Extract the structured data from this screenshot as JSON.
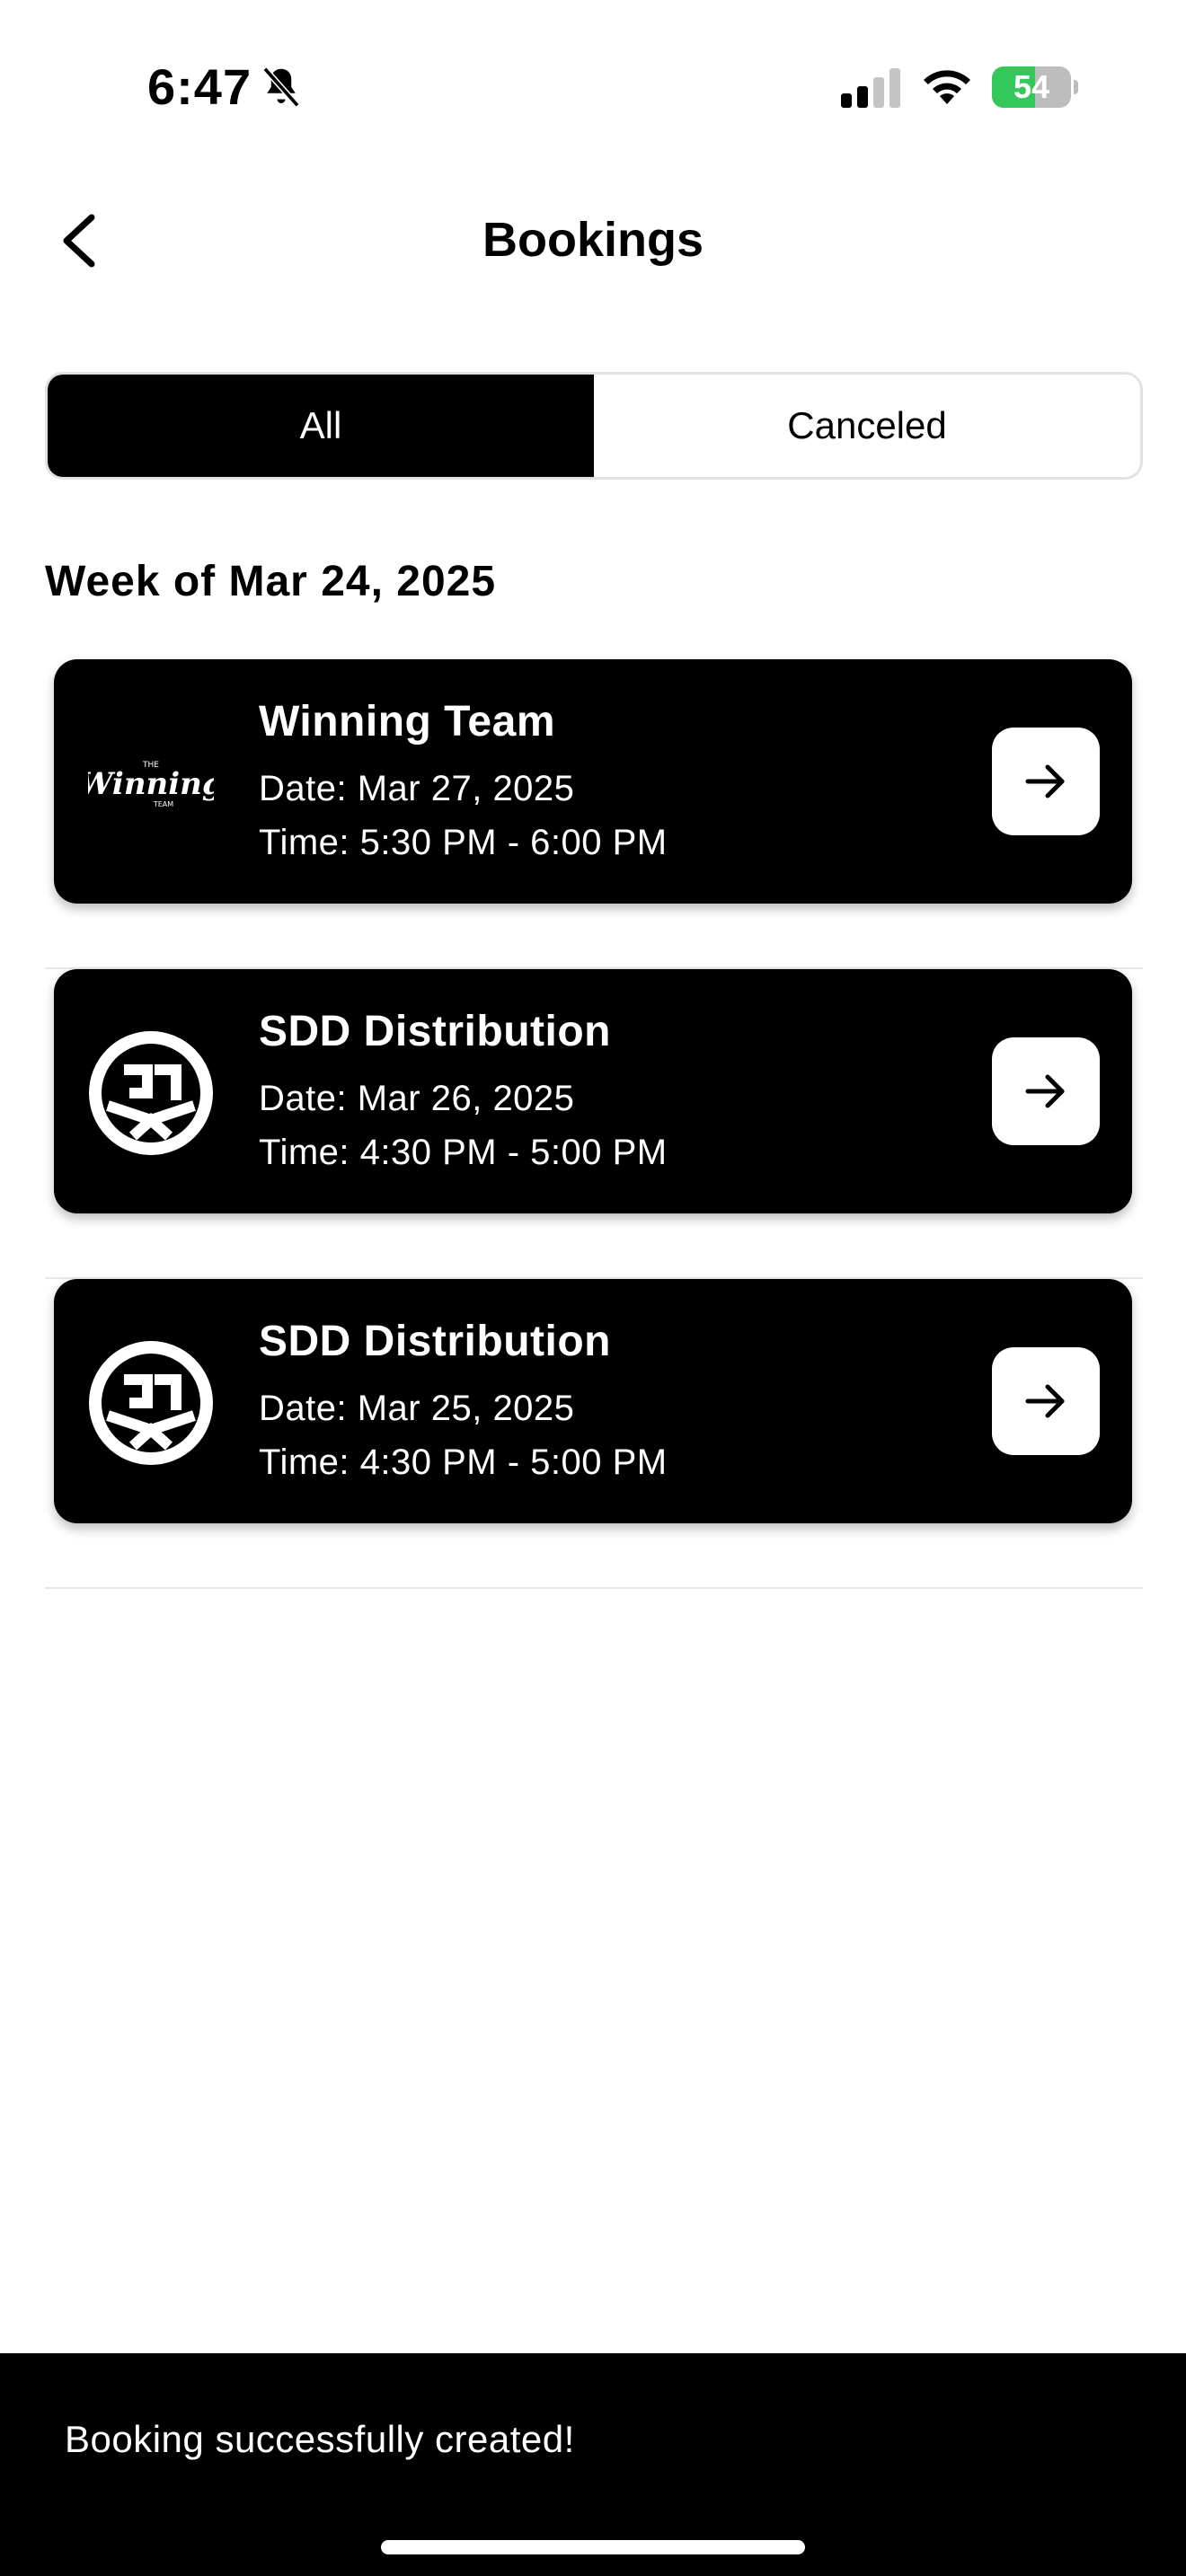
{
  "status_bar": {
    "time": "6:47",
    "battery_level": "54",
    "battery_fraction": 0.54,
    "battery_color": "#34c759",
    "icons": [
      "bell-slash-icon",
      "cellular-signal-icon",
      "wifi-icon",
      "battery-icon"
    ]
  },
  "header": {
    "title": "Bookings",
    "back_icon": "chevron-left-icon"
  },
  "tabs": [
    {
      "label": "All",
      "active": true
    },
    {
      "label": "Canceled",
      "active": false
    }
  ],
  "section": {
    "title": "Week of Mar 24, 2025"
  },
  "bookings": [
    {
      "name": "Winning Team",
      "date": "Date: Mar 27, 2025",
      "time": "Time: 5:30 PM - 6:00 PM",
      "logo_icon": "winning-team-logo-icon",
      "logo_text": "Winning"
    },
    {
      "name": "SDD Distribution",
      "date": "Date: Mar 26, 2025",
      "time": "Time: 4:30 PM - 5:00 PM",
      "logo_icon": "sdd-logo-icon"
    },
    {
      "name": "SDD Distribution",
      "date": "Date: Mar 25, 2025",
      "time": "Time: 4:30 PM - 5:00 PM",
      "logo_icon": "sdd-logo-icon"
    }
  ],
  "toast": {
    "message": "Booking successfully created!"
  }
}
